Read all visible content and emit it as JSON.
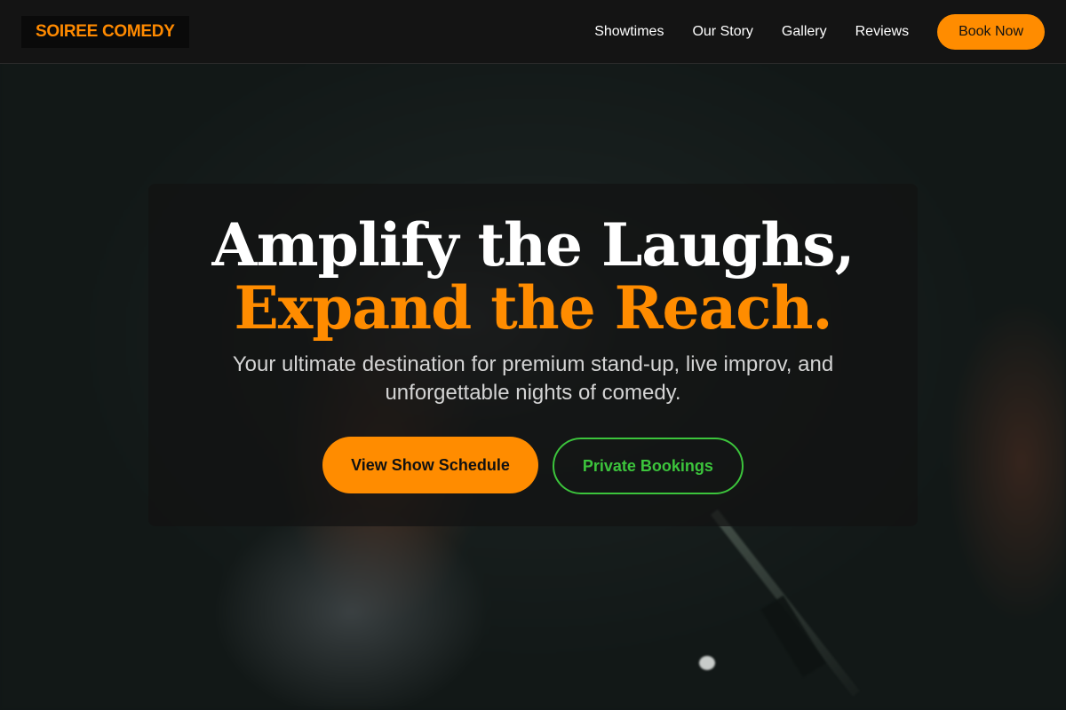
{
  "brand": {
    "name": "SOIREE COMEDY"
  },
  "nav": {
    "links": [
      "Showtimes",
      "Our Story",
      "Gallery",
      "Reviews"
    ],
    "cta_label": "Book Now"
  },
  "hero": {
    "headline_line1": "Amplify the Laughs,",
    "headline_line2": "Expand the Reach.",
    "subtitle": "Your ultimate destination for premium stand-up, live improv, and unforgettable nights of comedy.",
    "primary_cta": "View Show Schedule",
    "secondary_cta": "Private Bookings"
  },
  "colors": {
    "accent": "#ff8c00",
    "secondary_accent": "#3cc43c",
    "nav_background": "#141414"
  }
}
